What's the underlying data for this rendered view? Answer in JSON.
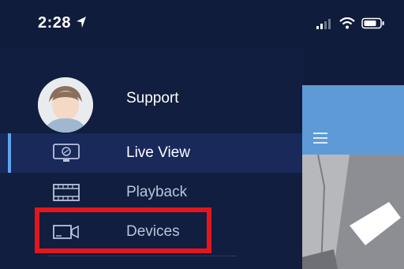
{
  "status_bar": {
    "time": "2:28",
    "icons": [
      "location-arrow-icon",
      "signal-icon",
      "wifi-icon",
      "battery-icon"
    ]
  },
  "drawer": {
    "profile": {
      "label": "Support"
    },
    "menu": [
      {
        "label": "Live View",
        "icon": "monitor-icon",
        "selected": true
      },
      {
        "label": "Playback",
        "icon": "film-icon",
        "selected": false
      },
      {
        "label": "Devices",
        "icon": "video-camera-icon",
        "selected": false
      }
    ]
  },
  "colors": {
    "drawer_bg": "#111e3f",
    "selected_row": "#18295a",
    "accent": "#5ea4ea",
    "highlight_box": "#e5161b",
    "header_blue": "#5e9bd6"
  }
}
